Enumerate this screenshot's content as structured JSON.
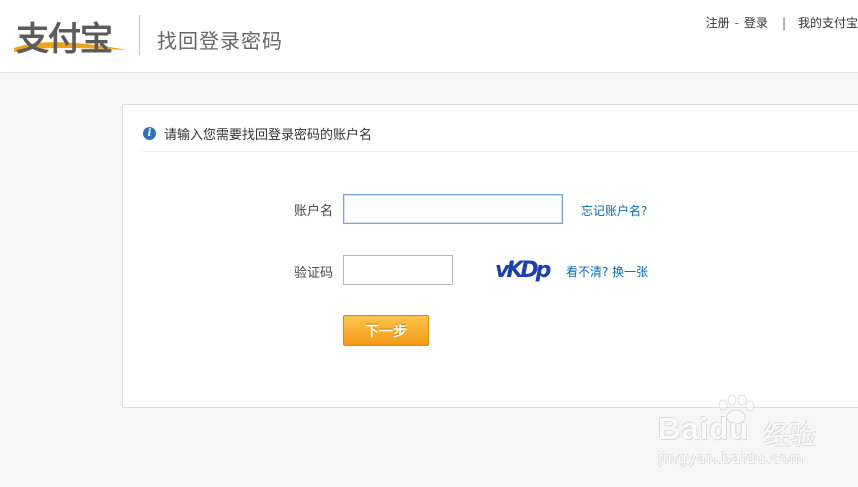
{
  "header": {
    "logo_text": "支付宝",
    "page_title": "找回登录密码",
    "links": {
      "register": "注册",
      "dash": "-",
      "login": "登录",
      "bar": "|",
      "my_alipay": "我的支付宝"
    }
  },
  "panel": {
    "notice": "请输入您需要找回登录密码的账户名",
    "account": {
      "label": "账户名",
      "value": "",
      "forgot_link": "忘记账户名?"
    },
    "captcha": {
      "label": "验证码",
      "value": "",
      "image_text": "vKDp",
      "refresh_link": "看不清? 换一张"
    },
    "next_button": "下一步"
  },
  "watermark": {
    "brand": "Bai",
    "brand2": "du",
    "sub": "经验",
    "url": "jingyan.baidu.com"
  },
  "colors": {
    "accent_link": "#0a6bb6",
    "button": "#f39a15",
    "info_icon": "#2e71b8"
  }
}
